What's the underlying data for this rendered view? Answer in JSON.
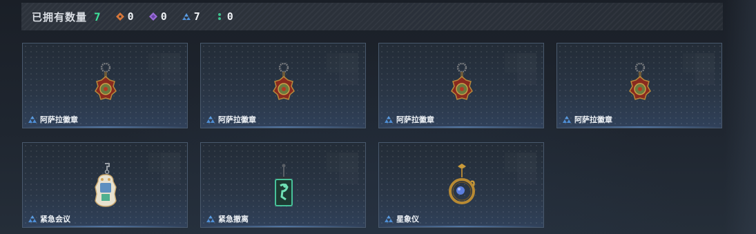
{
  "summary": {
    "label": "已拥有数量",
    "count": "7",
    "counters": [
      {
        "icon": "orange-diamond-icon",
        "color": "#d9783a",
        "value": "0"
      },
      {
        "icon": "purple-diamond-icon",
        "color": "#9a6bd8",
        "value": "0"
      },
      {
        "icon": "blue-triangle-icon",
        "color": "#4f8fd6",
        "value": "7"
      },
      {
        "icon": "green-dots-icon",
        "color": "#3ec28f",
        "value": "0"
      }
    ]
  },
  "items": [
    {
      "name": "阿萨拉徽章",
      "rarity_icon": "blue-triangle-icon",
      "art": "asala-badge-icon"
    },
    {
      "name": "阿萨拉徽章",
      "rarity_icon": "blue-triangle-icon",
      "art": "asala-badge-icon"
    },
    {
      "name": "阿萨拉徽章",
      "rarity_icon": "blue-triangle-icon",
      "art": "asala-badge-icon"
    },
    {
      "name": "阿萨拉徽章",
      "rarity_icon": "blue-triangle-icon",
      "art": "asala-badge-icon"
    },
    {
      "name": "紧急会议",
      "rarity_icon": "blue-triangle-icon",
      "art": "emergency-meeting-pendant-icon"
    },
    {
      "name": "紧急撤离",
      "rarity_icon": "blue-triangle-icon",
      "art": "emergency-evacuation-pendant-icon"
    },
    {
      "name": "星象仪",
      "rarity_icon": "blue-triangle-icon",
      "art": "astrolabe-pendant-icon"
    }
  ]
}
